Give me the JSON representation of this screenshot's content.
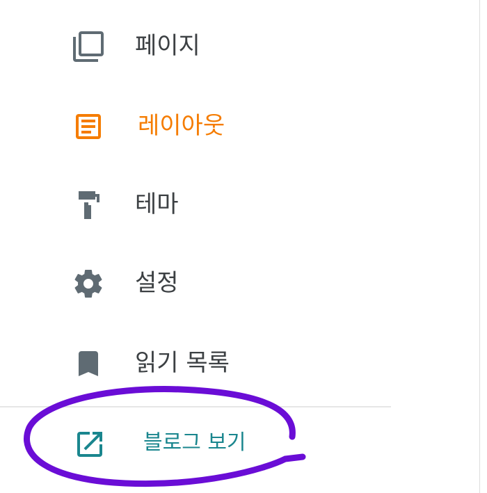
{
  "colors": {
    "text": "#3c4043",
    "icon": "#5f6b73",
    "active": "#f57c00",
    "link": "#1a868e",
    "annotation": "#6a0dd6"
  },
  "nav": {
    "items": [
      {
        "label": "페이지",
        "icon": "pages-icon",
        "active": false
      },
      {
        "label": "레이아웃",
        "icon": "layout-icon",
        "active": true
      },
      {
        "label": "테마",
        "icon": "paint-roller-icon",
        "active": false
      },
      {
        "label": "설정",
        "icon": "gear-icon",
        "active": false
      },
      {
        "label": "읽기 목록",
        "icon": "bookmark-icon",
        "active": false
      }
    ],
    "view_blog": {
      "label": "블로그 보기",
      "icon": "open-in-new-icon"
    }
  }
}
